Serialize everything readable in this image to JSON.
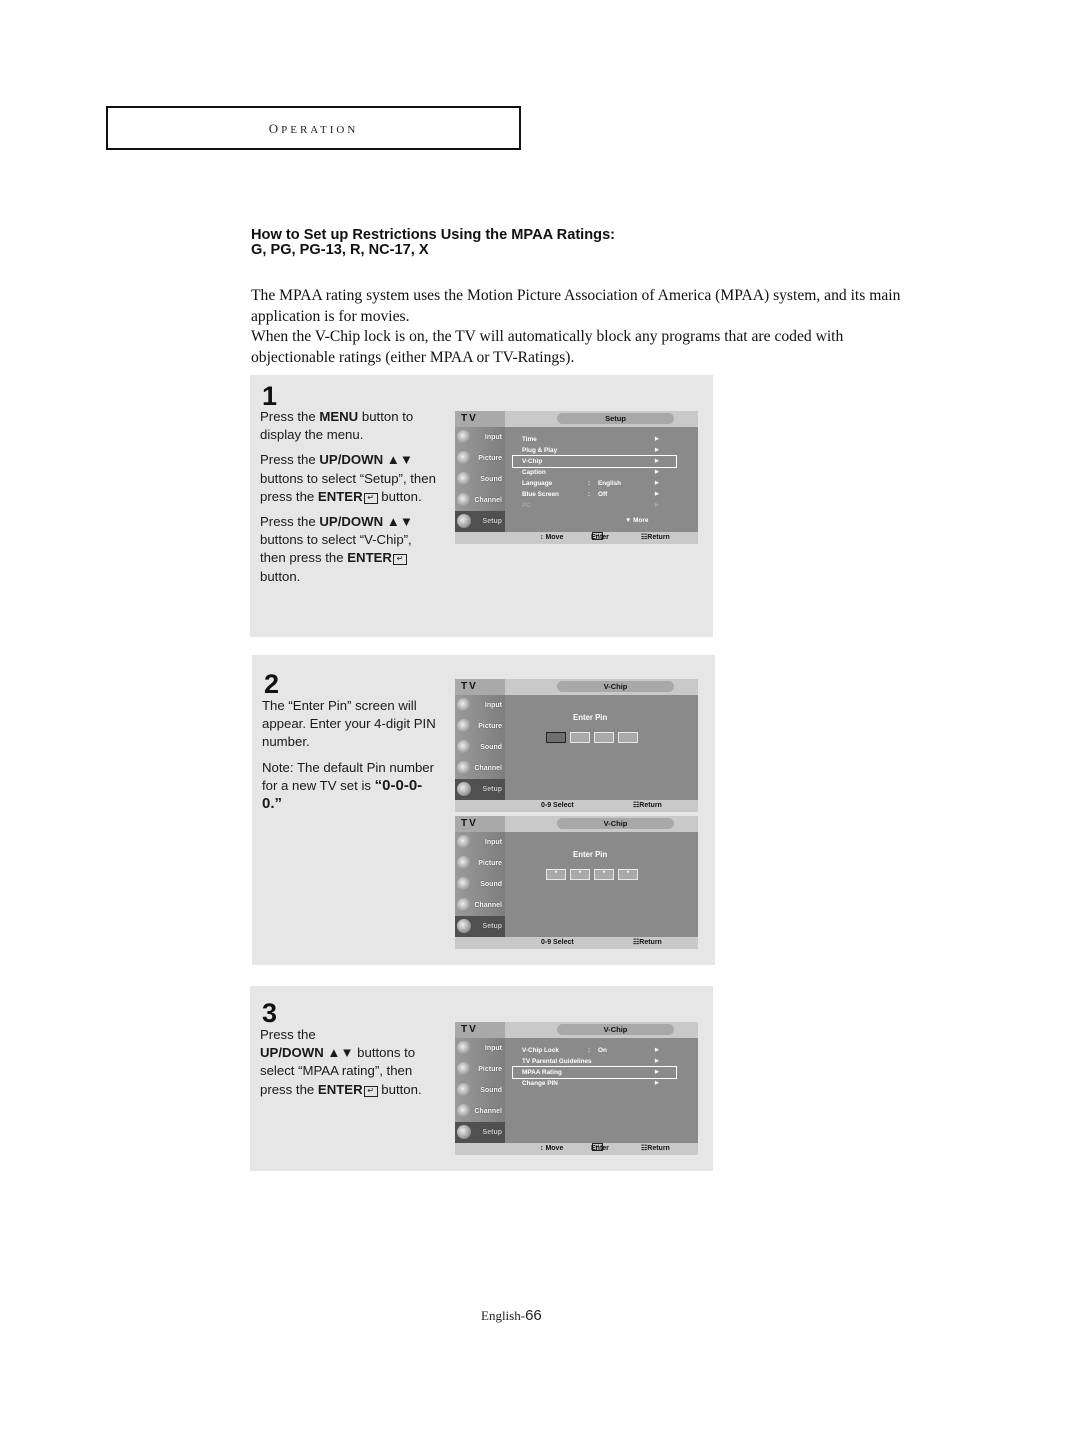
{
  "section": {
    "title": "Operation"
  },
  "heading": {
    "line1": "How to Set up Restrictions Using the MPAA Ratings:",
    "line2": "G, PG, PG-13, R, NC-17, X"
  },
  "intro": {
    "p1": "The MPAA rating system uses the Motion Picture Association of America (MPAA) system, and its main application is for movies.",
    "p2": "When the V-Chip lock is on, the TV will automatically block any programs that are coded with objectionable ratings (either MPAA or TV-Ratings)."
  },
  "steps": [
    {
      "number": "1",
      "paragraphs": [
        {
          "pre": "Press the ",
          "bold": "MENU",
          "post": " button to display the menu."
        },
        {
          "pre": "Press the ",
          "bold": "UP/DOWN ▲▼",
          "post": " buttons to select “Setup”, then press the ",
          "bold2": "ENTER",
          "post2": " button."
        },
        {
          "pre": "Press the ",
          "bold": "UP/DOWN ▲▼",
          "post": " buttons to select “V-Chip”, then press the ",
          "bold2": "ENTER",
          "post2": " button."
        }
      ]
    },
    {
      "number": "2",
      "paragraphs": [
        {
          "pre": "The “Enter Pin” screen will appear. Enter your 4-digit PIN number."
        },
        {
          "pre": "Note: The default Pin number for a new TV set is ",
          "bold": "“0-0-0-0.”"
        }
      ]
    },
    {
      "number": "3",
      "paragraphs": [
        {
          "pre": "Press the ",
          "bold": "UP/DOWN ▲▼",
          "post": " buttons to select “MPAA rating”, then press the ",
          "bold2": "ENTER",
          "post2": " button."
        }
      ]
    }
  ],
  "osd": {
    "tv_label": "TV",
    "sidebar": [
      "Input",
      "Picture",
      "Sound",
      "Channel",
      "Setup"
    ],
    "screen1": {
      "title": "Setup",
      "items": [
        {
          "label": "Time",
          "value": ""
        },
        {
          "label": "Plug & Play",
          "value": ""
        },
        {
          "label": "V-Chip",
          "value": ""
        },
        {
          "label": "Caption",
          "value": ""
        },
        {
          "label": "Language",
          "value": "English"
        },
        {
          "label": "Blue Screen",
          "value": "Off"
        },
        {
          "label": "PC",
          "value": ""
        }
      ],
      "selected_index": 2,
      "more": "▼ More",
      "footer": {
        "move": "↕ Move",
        "enter": "Enter",
        "return": "Return"
      }
    },
    "screen2": {
      "title": "V-Chip",
      "prompt": "Enter Pin",
      "pin_empty": [
        "",
        "",
        "",
        ""
      ],
      "footer": {
        "select": "0-9 Select",
        "return": "Return"
      }
    },
    "screen3": {
      "title": "V-Chip",
      "prompt": "Enter Pin",
      "pin_masked": [
        "*",
        "*",
        "*",
        "*"
      ],
      "footer": {
        "select": "0-9 Select",
        "return": "Return"
      }
    },
    "screen4": {
      "title": "V-Chip",
      "items": [
        {
          "label": "V-Chip Lock",
          "value": "On"
        },
        {
          "label": "TV Parental Guidelines",
          "value": ""
        },
        {
          "label": "MPAA Rating",
          "value": ""
        },
        {
          "label": "Change PIN",
          "value": ""
        }
      ],
      "selected_index": 2,
      "footer": {
        "move": "↕ Move",
        "enter": "Enter",
        "return": "Return"
      }
    }
  },
  "footer": {
    "lang": "English-",
    "page": "66"
  }
}
